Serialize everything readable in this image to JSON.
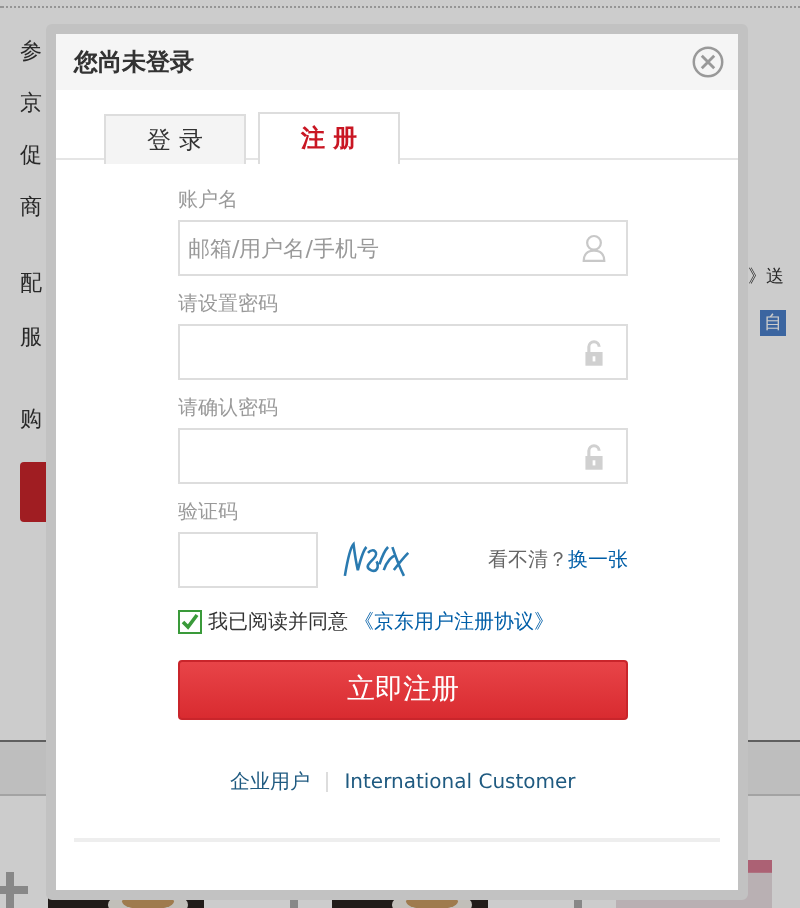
{
  "background_page": {
    "labels": [
      "参",
      "京",
      "促",
      "商",
      "配",
      "服",
      "购"
    ],
    "right_texts": [
      {
        "kind": "text",
        "text": "》送"
      },
      {
        "kind": "badge",
        "text": "自"
      }
    ]
  },
  "dialog": {
    "title": "您尚未登录",
    "tabs": [
      {
        "label": "登 录",
        "selected": false
      },
      {
        "label": "注 册",
        "selected": true
      }
    ],
    "fields": [
      {
        "label": "账户名",
        "placeholder": "邮箱/用户名/手机号",
        "kind": "account"
      },
      {
        "label": "请设置密码",
        "kind": "password"
      },
      {
        "label": "请确认密码",
        "kind": "password"
      }
    ],
    "captcha": {
      "label": "验证码",
      "hint": "看不清？",
      "refresh": "换一张"
    },
    "agreement": {
      "checked": true,
      "text": "我已阅读并同意",
      "link": "《京东用户注册协议》"
    },
    "submit": "立即注册",
    "footer_links": [
      "企业用户",
      "International Customer"
    ]
  }
}
